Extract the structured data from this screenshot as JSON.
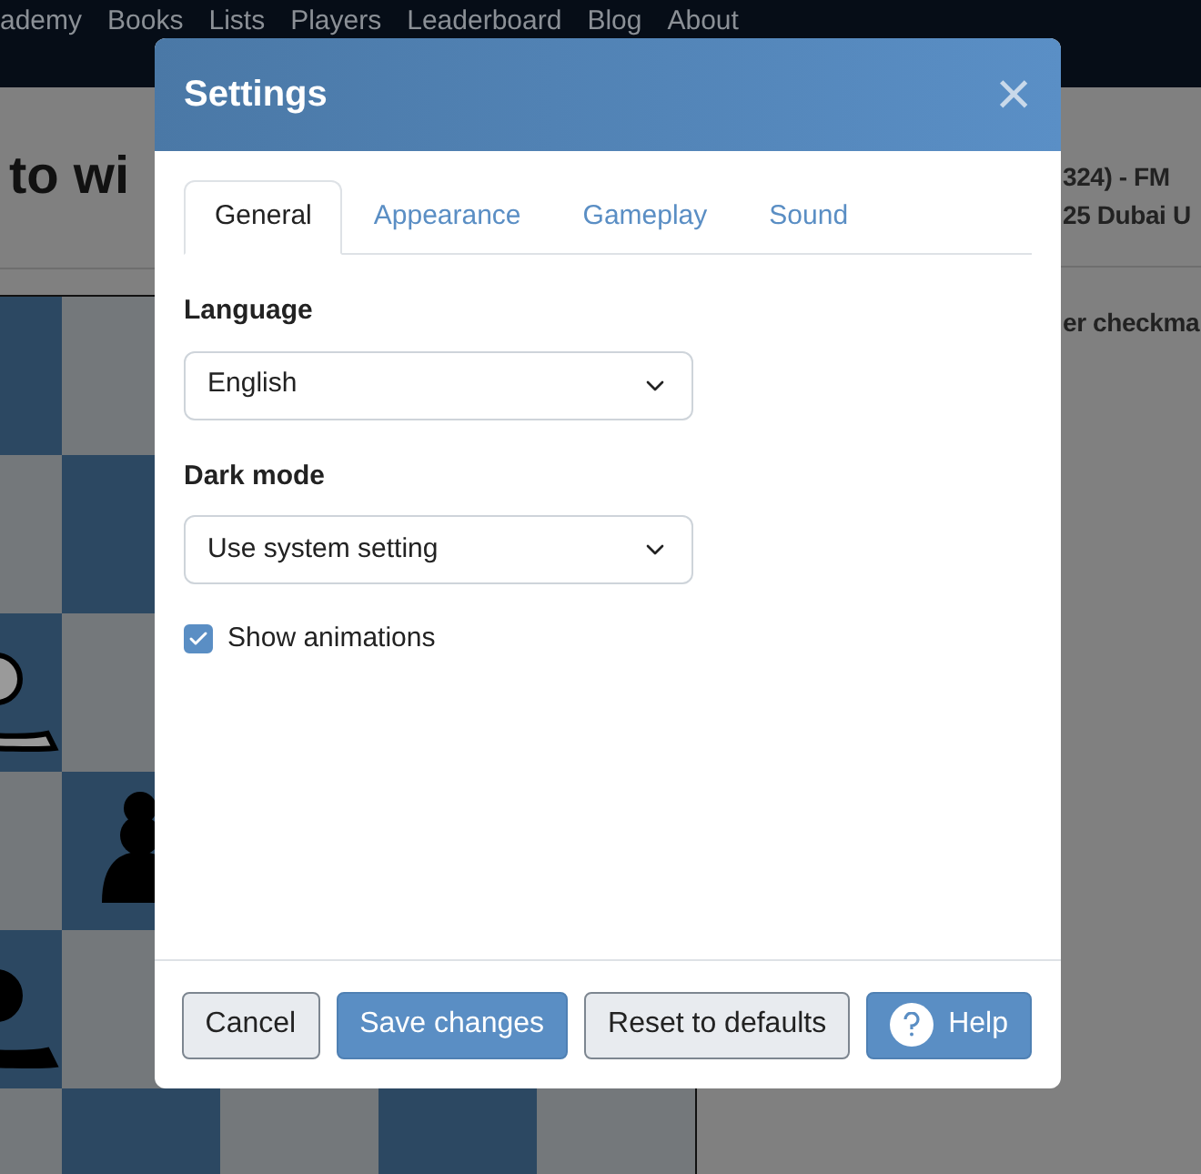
{
  "nav": {
    "items": [
      "ademy",
      "Books",
      "Lists",
      "Players",
      "Leaderboard",
      "Blog",
      "About"
    ]
  },
  "page": {
    "heading": "to wi",
    "info_lines": [
      "324) - FM",
      "25 Dubai U"
    ],
    "caption": "er checkma"
  },
  "board": {
    "pieces": [
      {
        "kind": "bishop",
        "color": "#9a9a9a"
      },
      {
        "kind": "pawn",
        "color": "#000000"
      },
      {
        "kind": "bishop",
        "color": "#000000"
      }
    ]
  },
  "dialog": {
    "title": "Settings",
    "close": "×",
    "tabs": [
      {
        "label": "General",
        "selected": true
      },
      {
        "label": "Appearance",
        "selected": false
      },
      {
        "label": "Gameplay",
        "selected": false
      },
      {
        "label": "Sound",
        "selected": false
      }
    ],
    "fields": [
      {
        "label": "Language",
        "value": "English"
      },
      {
        "label": "Dark mode",
        "value": "Use system setting"
      }
    ],
    "checkbox": {
      "label": "Show animations",
      "checked": true
    },
    "buttons": [
      {
        "label": "Cancel",
        "kind": "secondary"
      },
      {
        "label": "Save changes",
        "kind": "primary"
      },
      {
        "label": "Reset to defaults",
        "kind": "secondary"
      },
      {
        "label": "Help",
        "kind": "help"
      }
    ]
  }
}
